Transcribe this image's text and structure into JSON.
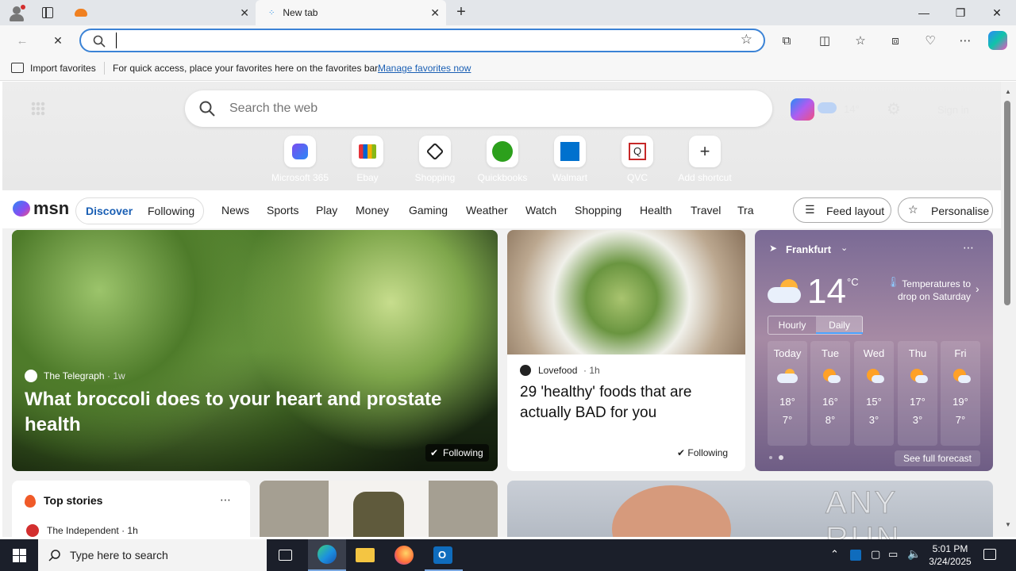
{
  "browser": {
    "tabs": [
      {
        "label": "",
        "active": false
      },
      {
        "label": "New tab",
        "active": true
      }
    ],
    "address_value": "",
    "favorites_bar": {
      "import_label": "Import favorites",
      "message": "For quick access, place your favorites here on the favorites bar.",
      "manage_link": "Manage favorites now"
    }
  },
  "msn": {
    "search_placeholder": "Search the web",
    "sign_in": "Sign in",
    "header_temp": "14°",
    "shortcuts": [
      {
        "label": "Microsoft 365",
        "icon": "microsoft365-icon"
      },
      {
        "label": "Ebay",
        "icon": "ebay-icon"
      },
      {
        "label": "Shopping",
        "icon": "shopping-tag-icon"
      },
      {
        "label": "Quickbooks",
        "icon": "quickbooks-icon"
      },
      {
        "label": "Walmart",
        "icon": "walmart-icon"
      },
      {
        "label": "QVC",
        "icon": "qvc-icon"
      },
      {
        "label": "Add shortcut",
        "icon": "plus-icon"
      }
    ],
    "logo": "msn",
    "feed_tabs": {
      "discover": "Discover",
      "following": "Following"
    },
    "nav_items": [
      "News",
      "Sports",
      "Play",
      "Money",
      "Gaming",
      "Weather",
      "Watch",
      "Shopping",
      "Health",
      "Travel",
      "Tra"
    ],
    "feed_layout": "Feed layout",
    "personalise": "Personalise"
  },
  "cards": {
    "hero": {
      "source": "The Telegraph",
      "age": "1w",
      "headline": "What broccoli does to your heart and prostate health",
      "following": "Following"
    },
    "food": {
      "source": "Lovefood",
      "age": "1h",
      "headline": "29 'healthy' foods that are actually BAD for you",
      "following": "Following"
    },
    "top_stories": {
      "title": "Top stories",
      "first_source": "The Independent · 1h"
    }
  },
  "weather": {
    "location": "Frankfurt",
    "temp": "14",
    "unit": "°C",
    "alert": "Temperatures to drop on Saturday",
    "tabs": [
      "Hourly",
      "Daily"
    ],
    "selected_tab": "Daily",
    "days": [
      {
        "day": "Today",
        "high": "18°",
        "low": "7°",
        "icon": "partly-cloudy-icon"
      },
      {
        "day": "Tue",
        "high": "16°",
        "low": "8°",
        "icon": "sun-cloud-icon"
      },
      {
        "day": "Wed",
        "high": "15°",
        "low": "3°",
        "icon": "sun-cloud-icon"
      },
      {
        "day": "Thu",
        "high": "17°",
        "low": "3°",
        "icon": "sun-cloud-icon"
      },
      {
        "day": "Fri",
        "high": "19°",
        "low": "7°",
        "icon": "sun-cloud-icon"
      }
    ],
    "see_forecast": "See full forecast"
  },
  "taskbar": {
    "search_placeholder": "Type here to search",
    "time": "5:01 PM",
    "date": "3/24/2025"
  },
  "watermark": "ANY RUN"
}
